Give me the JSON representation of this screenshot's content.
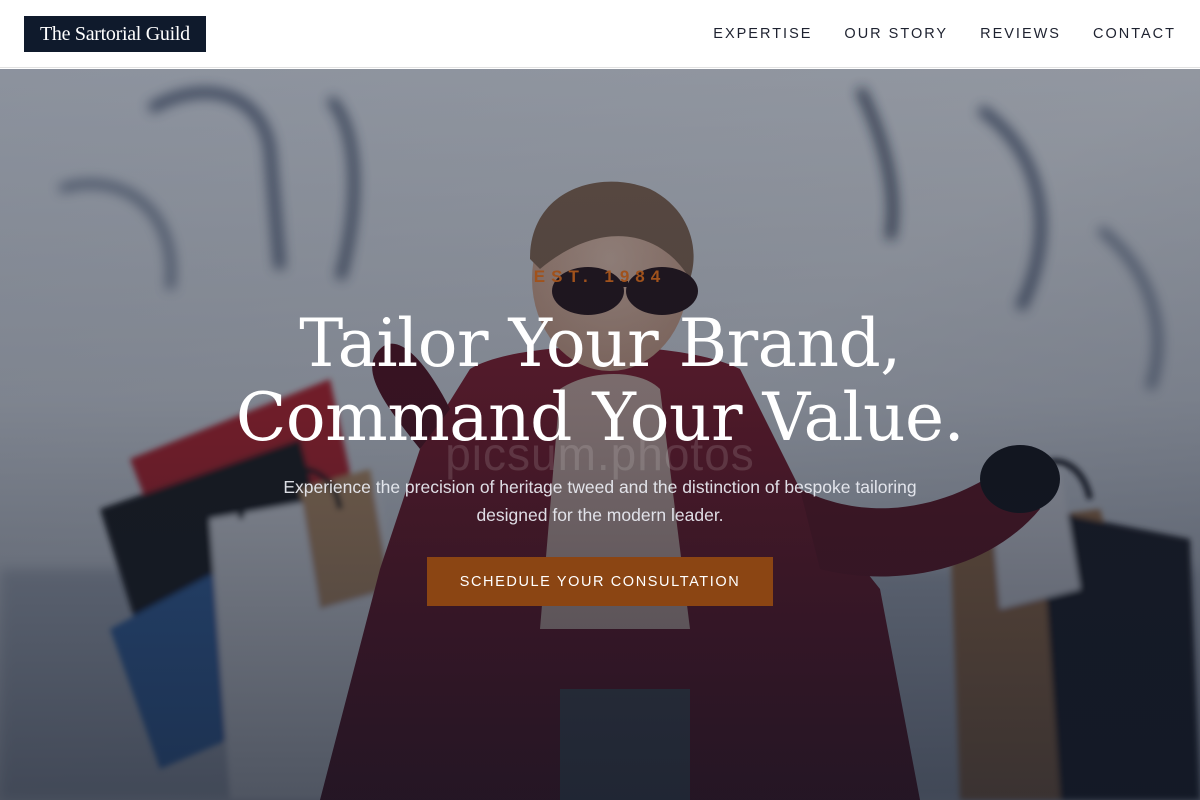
{
  "header": {
    "logo_text": "The Sartorial Guild",
    "nav": [
      {
        "label": "EXPERTISE"
      },
      {
        "label": "OUR STORY"
      },
      {
        "label": "REVIEWS"
      },
      {
        "label": "CONTACT"
      }
    ]
  },
  "hero": {
    "eyebrow": "EST. 1984",
    "headline_line1": "Tailor Your Brand,",
    "headline_line2": "Command Your Value.",
    "subtext": "Experience the precision of heritage tweed and the distinction of bespoke tailoring designed for the modern leader.",
    "cta_label": "SCHEDULE YOUR CONSULTATION",
    "watermark": "picsum.photos",
    "image_subject": "woman in sunglasses and red coat holding shopping bags"
  },
  "colors": {
    "logo_bg": "#0f1a2c",
    "accent": "#8b4513",
    "eyebrow": "#a0521c",
    "nav_text": "#1e2230"
  }
}
